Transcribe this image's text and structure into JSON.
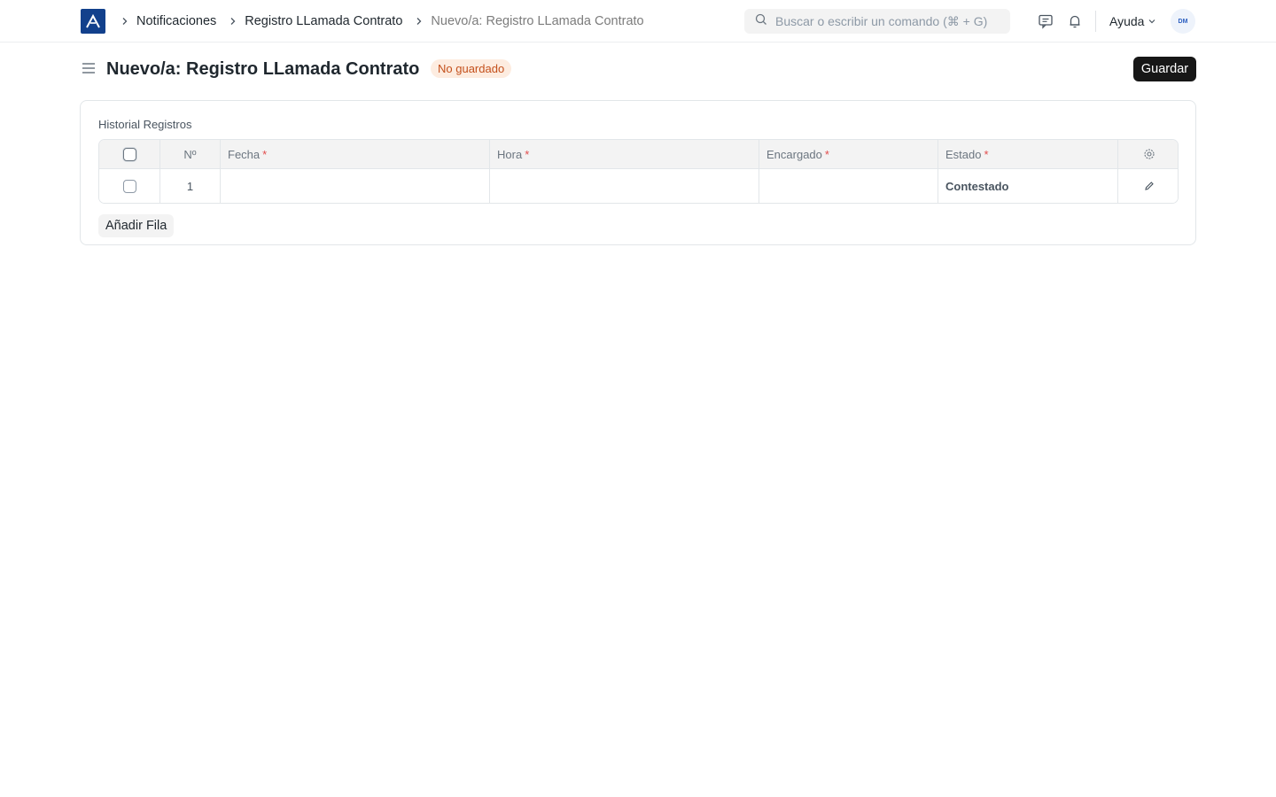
{
  "navbar": {
    "logo_icon": "app-logo-icon",
    "breadcrumbs": [
      {
        "label": "Notificaciones"
      },
      {
        "label": "Registro LLamada Contrato"
      },
      {
        "label": "Nuevo/a: Registro LLamada Contrato"
      }
    ],
    "search": {
      "placeholder": "Buscar o escribir un comando (⌘ + G)",
      "value": ""
    },
    "help_label": "Ayuda",
    "avatar_text": "DM"
  },
  "page": {
    "title": "Nuevo/a: Registro LLamada Contrato",
    "status": "No guardado",
    "save_label": "Guardar"
  },
  "section": {
    "label": "Historial Registros",
    "table": {
      "columns": [
        {
          "label": "Nº",
          "required": false
        },
        {
          "label": "Fecha",
          "required": true
        },
        {
          "label": "Hora",
          "required": true
        },
        {
          "label": "Encargado",
          "required": true
        },
        {
          "label": "Estado",
          "required": true
        }
      ],
      "required_mark": "*",
      "rows": [
        {
          "no": "1",
          "fecha": "",
          "hora": "",
          "encargado": "",
          "estado": "Contestado"
        }
      ]
    },
    "add_row_label": "Añadir Fila"
  },
  "colors": {
    "logo": "#12408c",
    "primary_button": "#171717",
    "status_bg": "#fdece0",
    "status_text": "#c4501c",
    "required": "#e24c4c"
  }
}
